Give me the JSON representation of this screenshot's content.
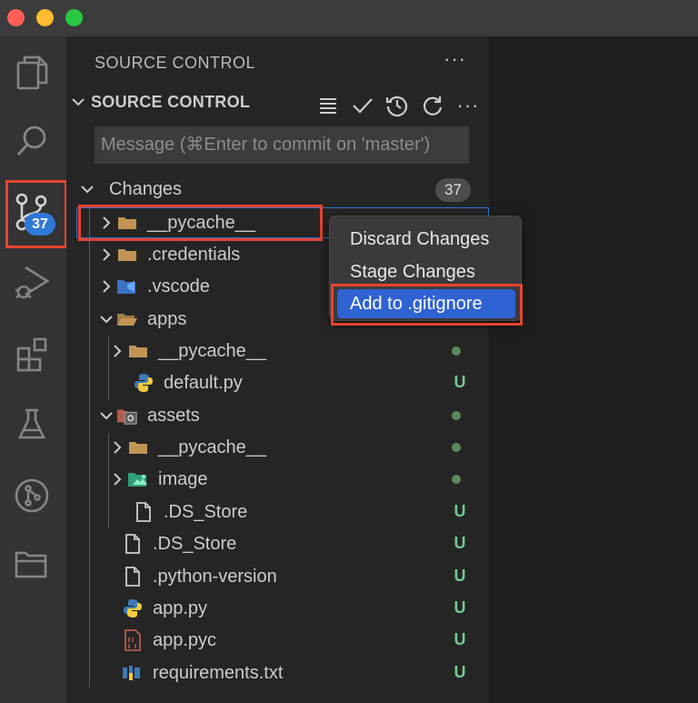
{
  "sidebar_header": {
    "title": "SOURCE CONTROL",
    "more": "···"
  },
  "section": {
    "title": "SOURCE CONTROL",
    "more": "···"
  },
  "commit": {
    "placeholder": "Message (⌘Enter to commit on 'master')"
  },
  "activity": {
    "scm_badge": "37"
  },
  "changes": {
    "label": "Changes",
    "count": "37"
  },
  "tree": [
    {
      "name": "__pycache__",
      "type": "folder",
      "status": ""
    },
    {
      "name": ".credentials",
      "type": "folder",
      "status": ""
    },
    {
      "name": ".vscode",
      "type": "vscode-folder",
      "status": ""
    },
    {
      "name": "apps",
      "type": "folder-open",
      "status": ""
    },
    {
      "name": "__pycache__",
      "type": "folder",
      "status": "dot"
    },
    {
      "name": "default.py",
      "type": "python",
      "status": "U"
    },
    {
      "name": "assets",
      "type": "assets-folder",
      "status": "dot"
    },
    {
      "name": "__pycache__",
      "type": "folder",
      "status": "dot"
    },
    {
      "name": "image",
      "type": "image-folder",
      "status": "dot"
    },
    {
      "name": ".DS_Store",
      "type": "file",
      "status": "U"
    },
    {
      "name": ".DS_Store",
      "type": "file",
      "status": "U"
    },
    {
      "name": ".python-version",
      "type": "file",
      "status": "U"
    },
    {
      "name": "app.py",
      "type": "python",
      "status": "U"
    },
    {
      "name": "app.pyc",
      "type": "binary",
      "status": "U"
    },
    {
      "name": "requirements.txt",
      "type": "pip",
      "status": "U"
    }
  ],
  "context_menu": {
    "items": [
      "Discard Changes",
      "Stage Changes",
      "Add to .gitignore"
    ],
    "active_index": 2
  },
  "colors": {
    "accent": "#2f79d7",
    "highlight": "#e8432f",
    "untracked": "#73c991"
  }
}
